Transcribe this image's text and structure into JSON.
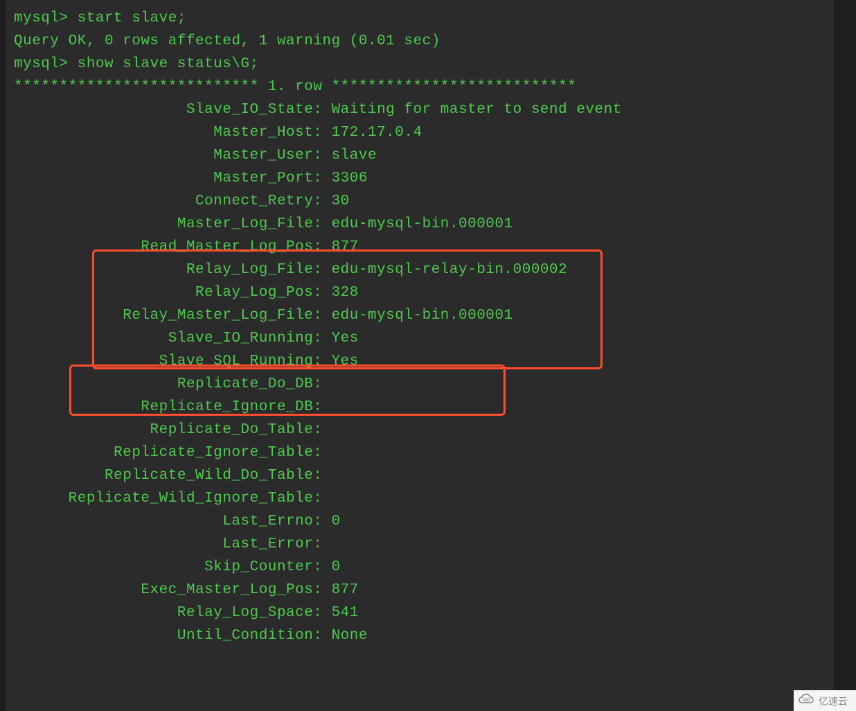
{
  "terminal": {
    "blank_top": "",
    "cmd1": "mysql> start slave;",
    "cmd1_result": "Query OK, 0 rows affected, 1 warning (0.01 sec)",
    "blank1": "",
    "cmd2": "mysql> show slave status\\G;",
    "row_header": "*************************** 1. row ***************************",
    "fields": [
      {
        "label": "Slave_IO_State",
        "value": "Waiting for master to send event"
      },
      {
        "label": "Master_Host",
        "value": "172.17.0.4"
      },
      {
        "label": "Master_User",
        "value": "slave"
      },
      {
        "label": "Master_Port",
        "value": "3306"
      },
      {
        "label": "Connect_Retry",
        "value": "30"
      },
      {
        "label": "Master_Log_File",
        "value": "edu-mysql-bin.000001"
      },
      {
        "label": "Read_Master_Log_Pos",
        "value": "877"
      },
      {
        "label": "Relay_Log_File",
        "value": "edu-mysql-relay-bin.000002"
      },
      {
        "label": "Relay_Log_Pos",
        "value": "328"
      },
      {
        "label": "Relay_Master_Log_File",
        "value": "edu-mysql-bin.000001"
      },
      {
        "label": "Slave_IO_Running",
        "value": "Yes"
      },
      {
        "label": "Slave_SQL_Running",
        "value": "Yes"
      },
      {
        "label": "Replicate_Do_DB",
        "value": ""
      },
      {
        "label": "Replicate_Ignore_DB",
        "value": ""
      },
      {
        "label": "Replicate_Do_Table",
        "value": ""
      },
      {
        "label": "Replicate_Ignore_Table",
        "value": ""
      },
      {
        "label": "Replicate_Wild_Do_Table",
        "value": ""
      },
      {
        "label": "Replicate_Wild_Ignore_Table",
        "value": ""
      },
      {
        "label": "Last_Errno",
        "value": "0"
      },
      {
        "label": "Last_Error",
        "value": ""
      },
      {
        "label": "Skip_Counter",
        "value": "0"
      },
      {
        "label": "Exec_Master_Log_Pos",
        "value": "877"
      },
      {
        "label": "Relay_Log_Space",
        "value": "541"
      },
      {
        "label": "Until_Condition",
        "value": "None"
      }
    ],
    "label_width": 33
  },
  "watermark": {
    "text": "亿速云"
  }
}
